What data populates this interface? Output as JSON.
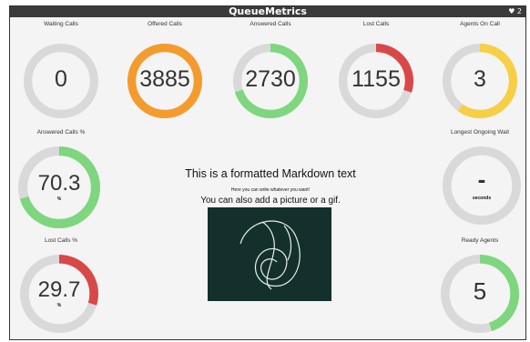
{
  "header": {
    "title": "QueueMetrics",
    "right_text": "♥ 2"
  },
  "tiles": [
    {
      "id": "waiting",
      "label": "Waiting Calls",
      "value": "0",
      "unit": "",
      "color": "#d9d9d9",
      "fraction": 0
    },
    {
      "id": "offered",
      "label": "Offered Calls",
      "value": "3885",
      "unit": "",
      "color": "#f39c2d",
      "fraction": 1
    },
    {
      "id": "answered",
      "label": "Answered Calls",
      "value": "2730",
      "unit": "",
      "color": "#7ed67e",
      "fraction": 0.7
    },
    {
      "id": "lost",
      "label": "Lost Calls",
      "value": "1155",
      "unit": "",
      "color": "#d94848",
      "fraction": 0.3
    },
    {
      "id": "agents-on-call",
      "label": "Agents On Call",
      "value": "3",
      "unit": "",
      "color": "#f6cf45",
      "fraction": 0.6
    },
    {
      "id": "answered-pct",
      "label": "Answered Calls %",
      "value": "70.3",
      "unit": "%",
      "color": "#7ed67e",
      "fraction": 0.703
    },
    {
      "id": "longest-wait",
      "label": "Longest Ongoing Wait",
      "value": "-",
      "unit": "seconds",
      "color": "#d9d9d9",
      "fraction": 0
    },
    {
      "id": "lost-pct",
      "label": "Lost Calls %",
      "value": "29.7",
      "unit": "%",
      "color": "#d94848",
      "fraction": 0.297
    },
    {
      "id": "ready-agents",
      "label": "Ready Agents",
      "value": "5",
      "unit": "",
      "color": "#7ed67e",
      "fraction": 0.45
    }
  ],
  "markdown": {
    "heading": "This is a formatted Markdown text",
    "paragraph": "Here you can write whatever you want!",
    "subheading": "You can also add a picture or a gif."
  },
  "colors": {
    "track": "#d9d9d9",
    "titlebar": "#3b3b3b",
    "image_bg": "#13302c"
  }
}
